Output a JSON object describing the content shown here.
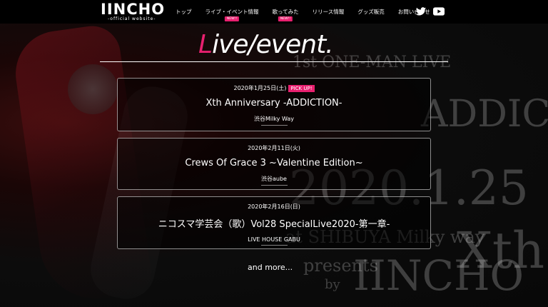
{
  "header": {
    "logo_text": "IINCHO",
    "logo_sub": "-official website-",
    "nav": [
      {
        "label": "トップ",
        "badge": ""
      },
      {
        "label": "ライブ・イベント情報",
        "badge": "NEW!!"
      },
      {
        "label": "歌ってみた",
        "badge": "NEW!!"
      },
      {
        "label": "リリース情報",
        "badge": ""
      },
      {
        "label": "グッズ販売",
        "badge": ""
      },
      {
        "label": "お問い合わせ",
        "badge": ""
      }
    ],
    "twitter_icon": "twitter-icon",
    "youtube_icon": "youtube-icon"
  },
  "page": {
    "title_first": "L",
    "title_rest": "ive/event.",
    "accent_color": "#e8206f"
  },
  "events": [
    {
      "date": "2020年1月25日(土)",
      "badge": "PICK UP!",
      "name": "Xth Anniversary -ADDICTION-",
      "venue": "渋谷Milky Way"
    },
    {
      "date": "2020年2月11日(火)",
      "badge": "",
      "name": "Crews Of Grace 3 ~Valentine Edition~",
      "venue": "渋谷aube"
    },
    {
      "date": "2020年2月16日(日)",
      "badge": "",
      "name": "ニコスマ学芸会（歌）Vol28 SpecialLive2020-第一章-",
      "venue": "LIVE HOUSE GABU"
    }
  ],
  "more_label": "and more...",
  "background": {
    "line1": "1st ONE-MAN LIVE",
    "line2": "ADDICTION",
    "line3": "2020.1.25",
    "line4": "at SHIBUYA Milky way",
    "line5": "presents",
    "line6": "IINCHO",
    "line7": "by",
    "line8": "Xth"
  }
}
